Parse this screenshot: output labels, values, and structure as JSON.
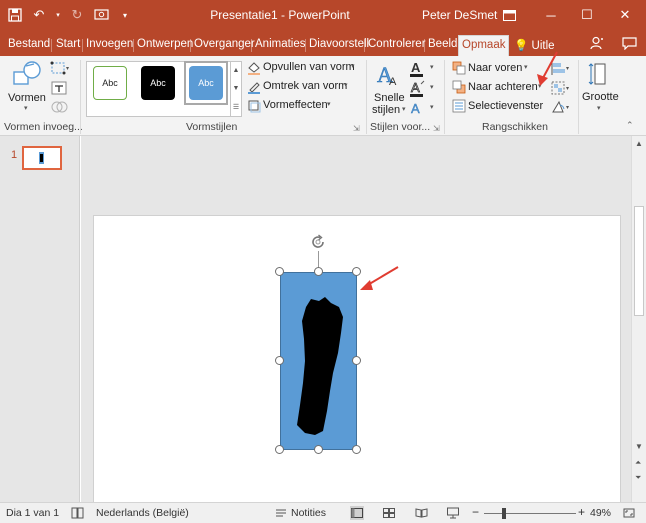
{
  "app": {
    "title": "Presentatie1 - PowerPoint",
    "user": "Peter DeSmet"
  },
  "tabs": [
    {
      "label": "Bestand"
    },
    {
      "label": "Start"
    },
    {
      "label": "Invoegen"
    },
    {
      "label": "Ontwerpen"
    },
    {
      "label": "Overganger"
    },
    {
      "label": "Animaties"
    },
    {
      "label": "Diavoorstell"
    },
    {
      "label": "Controlerer"
    },
    {
      "label": "Beeld"
    },
    {
      "label": "Opmaak"
    },
    {
      "label": "Uitle"
    }
  ],
  "ribbon": {
    "shapes_button": "Vormen",
    "group_insert_shapes": "Vormen invoeg...",
    "style_samples": [
      "Abc",
      "Abc",
      "Abc"
    ],
    "fill": "Opvullen van vorm",
    "outline": "Omtrek van vorm",
    "effects": "Vormeffecten",
    "group_shape_styles": "Vormstijlen",
    "quick_styles": [
      "Snelle",
      "stijlen"
    ],
    "group_wordart": "Stijlen voor...",
    "bring_forward": "Naar voren",
    "send_backward": "Naar achteren",
    "selection_pane": "Selectievenster",
    "group_arrange": "Rangschikken",
    "size": "Grootte"
  },
  "slides_pane": {
    "slide_number": "1"
  },
  "status": {
    "slide_info": "Dia 1 van 1",
    "language": "Nederlands (België)",
    "notes": "Notities",
    "zoom": "49%",
    "zoom_percent": 49
  },
  "colors": {
    "accent": "#b7472a",
    "shape_fill": "#5b9bd5",
    "annotation_arrow": "#e03c31"
  }
}
